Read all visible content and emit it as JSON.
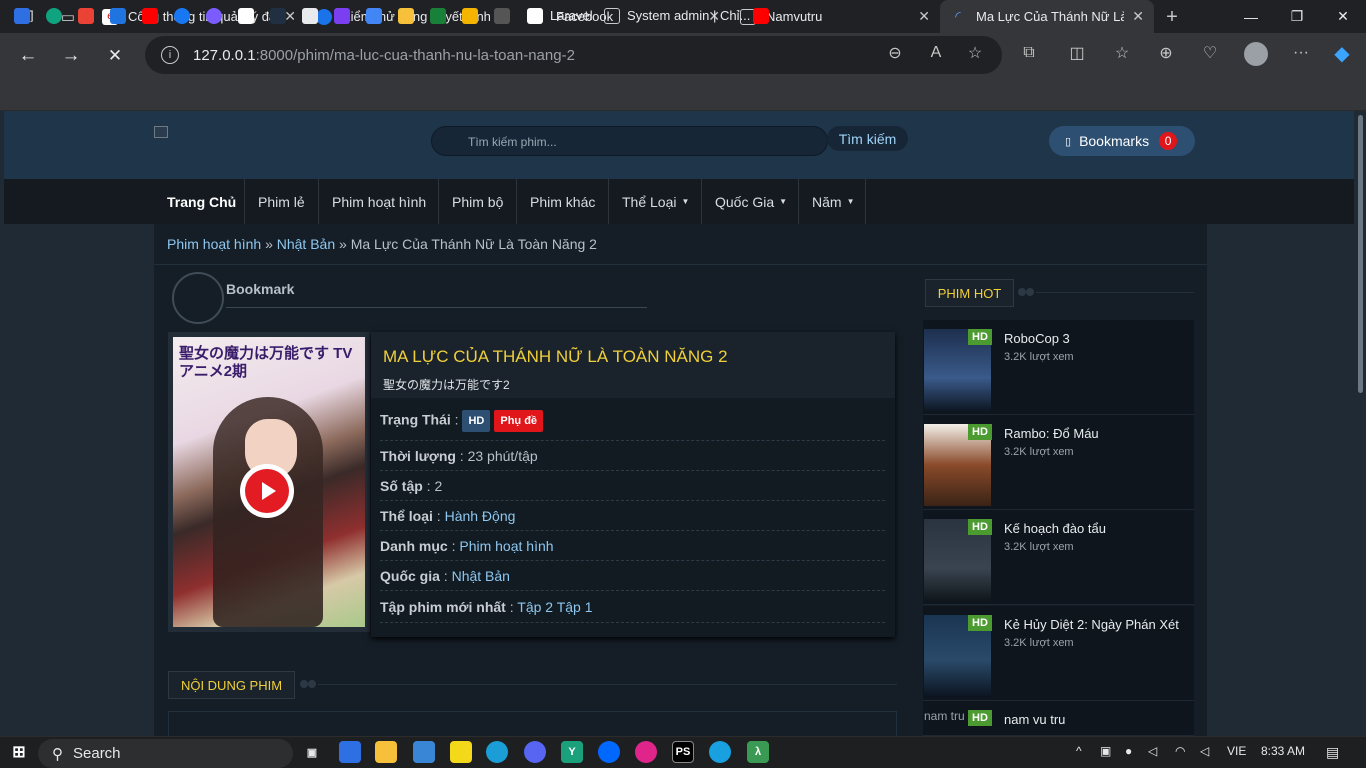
{
  "browser": {
    "tabs": [
      {
        "title": "Cổng thông tin quản lý đào",
        "favicon_color": "#e8f0fe"
      },
      {
        "title": "Kiểm thử bảng quyết định (",
        "favicon_color": "#1a73e8"
      },
      {
        "title": "Facebook",
        "favicon_color": "#1877f2"
      },
      {
        "title": "Namvutru",
        "favicon_color": "#9aa0a6"
      },
      {
        "title": "Ma Lực Của Thánh Nữ Là To",
        "favicon_color": "#1a73e8"
      }
    ],
    "url_host": "127.0.0.1",
    "url_rest": ":8000/phim/ma-luc-cua-thanh-nu-la-toan-nang-2",
    "bookmarks": [
      {
        "label": "Laravel"
      },
      {
        "label": "System admin | Chỉ..."
      }
    ]
  },
  "site": {
    "search_placeholder": "Tìm kiếm phim...",
    "search_button": "Tìm kiếm",
    "bookmarks_button": "Bookmarks",
    "bookmarks_count": "0",
    "menu": [
      "Trang Chủ",
      "Phim lẻ",
      "Phim hoạt hình",
      "Phim bộ",
      "Phim khác",
      "Thể Loại",
      "Quốc Gia",
      "Năm"
    ],
    "breadcrumb": {
      "c1": "Phim hoạt hình",
      "c2": "Nhật Bản",
      "current": "Ma Lực Của Thánh Nữ Là Toàn Năng 2",
      "sep": "»"
    }
  },
  "movie": {
    "bookmark_label": "Bookmark",
    "poster_text": "聖女の魔力は万能です TVアニメ2期",
    "title": "MA LỰC CỦA THÁNH NỮ LÀ TOÀN NĂNG 2",
    "original_title": "聖女の魔力は万能です2",
    "status_label": "Trạng Thái",
    "badge_quality": "HD",
    "badge_sub": "Phụ đề",
    "duration_label": "Thời lượng",
    "duration": "23 phút/tập",
    "episodes_label": "Số tập",
    "episodes": "2",
    "genre_label": "Thể loại",
    "genre": "Hành Động",
    "category_label": "Danh mục",
    "category": "Phim hoạt hình",
    "country_label": "Quốc gia",
    "country": "Nhật Bản",
    "latest_label": "Tập phim mới nhất",
    "latest_1": "Tập 2",
    "latest_2": "Tập 1",
    "content_header": "NỘI DUNG PHIM"
  },
  "sidebar": {
    "header": "PHIM HOT",
    "items": [
      {
        "name": "RoboCop 3",
        "views": "3.2K lượt xem",
        "badge": "HD",
        "thumb_color": "#3a5a8a"
      },
      {
        "name": "Rambo: Đổ Máu",
        "views": "3.2K lượt xem",
        "badge": "HD",
        "thumb_color": "#8a4a2a"
      },
      {
        "name": "Kế hoạch đào tẩu",
        "views": "3.2K lượt xem",
        "badge": "HD",
        "thumb_color": "#3a4450"
      },
      {
        "name": "Kẻ Hủy Diệt 2: Ngày Phán Xét",
        "views": "3.2K lượt xem",
        "badge": "HD",
        "thumb_color": "#2a4a6a"
      },
      {
        "name": "nam vu tru",
        "views": "",
        "badge": "HD",
        "thumb_alt": "nam tru"
      }
    ]
  },
  "taskbar": {
    "search": "Search",
    "lang": "VIE",
    "time": "8:33 AM"
  }
}
